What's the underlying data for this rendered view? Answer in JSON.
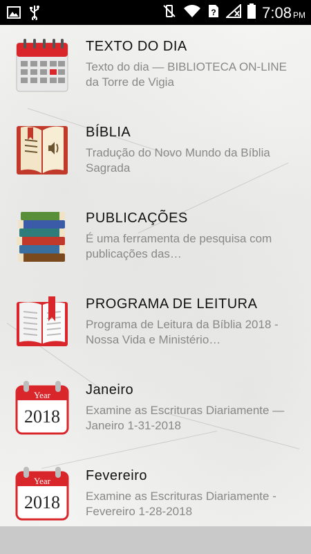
{
  "status_bar": {
    "time": "7:08",
    "ampm": "PM"
  },
  "items": [
    {
      "title": "TEXTO DO DIA",
      "subtitle": "Texto do dia — BIBLIOTECA ON-LINE da Torre de Vigia",
      "icon": "calendar-icon"
    },
    {
      "title": "BÍBLIA",
      "subtitle": "Tradução do Novo Mundo da Bíblia Sagrada",
      "icon": "audio-book-icon"
    },
    {
      "title": "PUBLICAÇÕES",
      "subtitle": "É uma ferramenta de pesquisa com publicações das…",
      "icon": "book-stack-icon"
    },
    {
      "title": "PROGRAMA DE LEITURA",
      "subtitle": "Programa de Leitura da Bíblia 2018 - Nossa Vida e Ministério…",
      "icon": "open-book-icon"
    },
    {
      "title": "Janeiro",
      "subtitle": "Examine as Escrituras Diariamente — Janeiro 1-31-2018",
      "icon": "year-calendar-icon",
      "icon_label": "Year",
      "icon_year": "2018"
    },
    {
      "title": "Fevereiro",
      "subtitle": "Examine as Escrituras Diariamente - Fevereiro 1-28-2018",
      "icon": "year-calendar-icon",
      "icon_label": "Year",
      "icon_year": "2018"
    }
  ],
  "colors": {
    "accent_red": "#d9262a",
    "status_bar": "#000000",
    "subtitle_gray": "#888888"
  }
}
